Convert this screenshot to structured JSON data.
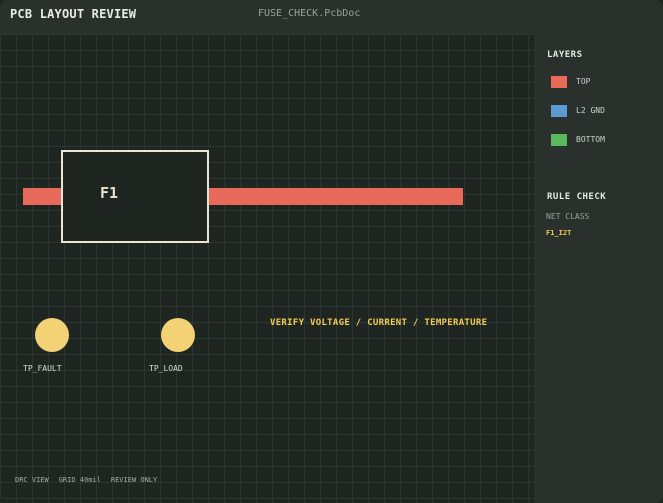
{
  "titlebar": {
    "app_title": "PCB LAYOUT REVIEW",
    "document": "FUSE_CHECK.PcbDoc"
  },
  "canvas": {
    "component": {
      "designator": "F1"
    },
    "test_points": [
      {
        "label": "TP_FAULT"
      },
      {
        "label": "TP_LOAD"
      }
    ],
    "note": "VERIFY VOLTAGE / CURRENT / TEMPERATURE",
    "status_bar": [
      "DRC VIEW",
      "GRID 40mil",
      "REVIEW ONLY"
    ]
  },
  "sidebar": {
    "layers_title": "LAYERS",
    "layers": [
      {
        "label": "TOP",
        "color": "#e76a5b"
      },
      {
        "label": "L2 GND",
        "color": "#5b9bd5"
      },
      {
        "label": "BOTTOM",
        "color": "#5cb85c"
      }
    ],
    "rule_title": "RULE CHECK",
    "net_class_label": "NET CLASS",
    "net_class_value": "F1_I2T"
  },
  "colors": {
    "trace_top": "#e76a5b",
    "accent": "#f2cb58",
    "test_point": "#f2d275",
    "component_outline": "#ece4d2"
  }
}
